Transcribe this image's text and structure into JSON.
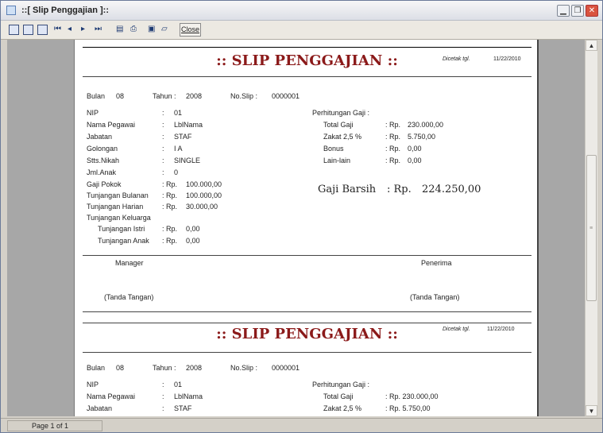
{
  "window": {
    "title": "::[ Slip Penggajian ]::",
    "close_label": "Close",
    "status": "Page 1 of 1"
  },
  "slip": {
    "heading": ":: SLIP PENGGAJIAN ::",
    "printed_label": "Dicetak tgl.",
    "printed_date": "11/22/2010",
    "bulan_label": "Bulan",
    "bulan": "08",
    "tahun_label": "Tahun :",
    "tahun": "2008",
    "noslip_label": "No.Slip :",
    "noslip": "0000001",
    "fields": [
      {
        "label": "NIP",
        "sep": ":",
        "value": "01"
      },
      {
        "label": "Nama Pegawai",
        "sep": ":",
        "value": "LblNama"
      },
      {
        "label": "Jabatan",
        "sep": ":",
        "value": "STAF"
      },
      {
        "label": "Golongan",
        "sep": ":",
        "value": "I A"
      },
      {
        "label": "Stts.Nikah",
        "sep": ":",
        "value": "SINGLE"
      },
      {
        "label": "Jml.Anak",
        "sep": ":",
        "value": "0"
      },
      {
        "label": "Gaji Pokok",
        "sep": ": Rp.",
        "value": "100.000,00"
      },
      {
        "label": "Tunjangan Bulanan",
        "sep": ": Rp.",
        "value": "100.000,00"
      },
      {
        "label": "Tunjangan Harian",
        "sep": ": Rp.",
        "value": "30.000,00"
      },
      {
        "label": "Tunjangan Keluarga",
        "sep": "",
        "value": ""
      },
      {
        "label": "Tunjangan Istri",
        "sep": ": Rp.",
        "value": "0,00"
      },
      {
        "label": "Tunjangan Anak",
        "sep": ": Rp.",
        "value": "0,00"
      }
    ],
    "calc_title": "Perhitungan Gaji :",
    "calc": [
      {
        "label": "Total Gaji",
        "sep": ": Rp.",
        "value": "230.000,00"
      },
      {
        "label": "Zakat 2,5 %",
        "sep": ": Rp.",
        "value": "5.750,00"
      },
      {
        "label": "Bonus",
        "sep": ": Rp.",
        "value": "0,00"
      },
      {
        "label": "Lain-lain",
        "sep": ": Rp.",
        "value": "0,00"
      }
    ],
    "net_label": "Gaji Barsih",
    "net_sep": ": Rp.",
    "net_value": "224.250,00",
    "manager": "Manager",
    "receiver": "Penerima",
    "sign": "(Tanda Tangan)"
  },
  "slip2": {
    "fields": [
      {
        "label": "NIP",
        "sep": ":",
        "value": "01"
      },
      {
        "label": "Nama Pegawai",
        "sep": ":",
        "value": "LblNama"
      },
      {
        "label": "Jabatan",
        "sep": ":",
        "value": "STAF"
      }
    ],
    "calc": [
      {
        "label": "Total Gaji",
        "value": ": Rp. 230.000,00"
      },
      {
        "label": "Zakat 2,5 %",
        "value": ": Rp. 5.750,00"
      }
    ]
  }
}
